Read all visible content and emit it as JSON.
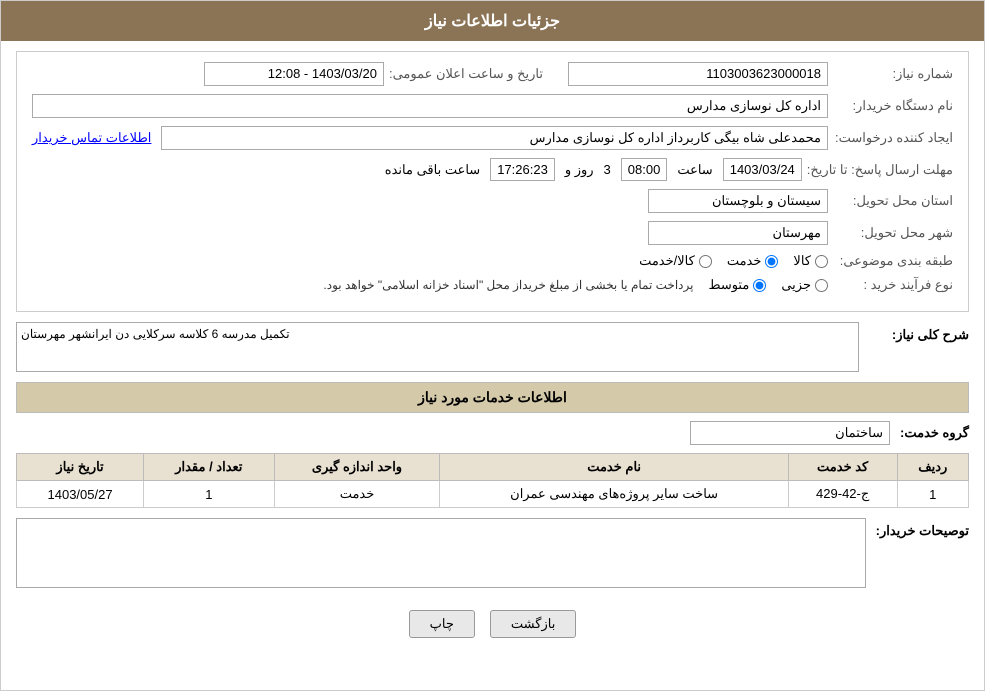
{
  "header": {
    "title": "جزئیات اطلاعات نیاز"
  },
  "fields": {
    "shomareNiaz_label": "شماره نیاز:",
    "shomareNiaz_value": "1103003623000018",
    "tarikh_label": "تاریخ و ساعت اعلان عمومی:",
    "tarikh_value": "1403/03/20 - 12:08",
    "namDastgah_label": "نام دستگاه خریدار:",
    "namDastgah_value": "اداره کل نوسازی مدارس",
    "ijadKonande_label": "ایجاد کننده درخواست:",
    "ijadKonande_value": "محمدعلی شاه بیگی کاربرداز اداره کل نوسازی مدارس",
    "ijadKonande_link": "اطلاعات تماس خریدار",
    "mohlatErsalPasokhTa_label": "مهلت ارسال پاسخ: تا تاریخ:",
    "mohlatDate_value": "1403/03/24",
    "mohlatSaat_label": "ساعت",
    "mohlatSaat_value": "08:00",
    "roz_label": "روز و",
    "roz_value": "3",
    "saat_label": "ساعت باقی مانده",
    "countdown_value": "17:26:23",
    "ostan_label": "استان محل تحویل:",
    "ostan_value": "سیستان و بلوچستان",
    "shahr_label": "شهر محل تحویل:",
    "shahr_value": "مهرستان",
    "tabaqeBandi_label": "طبقه بندی موضوعی:",
    "tabaqeRadios": [
      {
        "label": "کالا",
        "value": "kala"
      },
      {
        "label": "خدمت",
        "value": "khedmat"
      },
      {
        "label": "کالا/خدمت",
        "value": "kala_khedmat"
      }
    ],
    "tabaqeSelected": "khedmat",
    "noeFarayand_label": "نوع فرآیند خرید :",
    "noeFarayandRadios": [
      {
        "label": "جزیی",
        "value": "jozii"
      },
      {
        "label": "متوسط",
        "value": "motavasset"
      }
    ],
    "noeFarayandSelected": "motavasset",
    "noeFarayandNote": "پرداخت تمام یا بخشی از مبلغ خریداز محل \"اسناد خزانه اسلامی\" خواهد بود.",
    "sharhKoli_label": "شرح کلی نیاز:",
    "sharhKoli_value": "تکمیل مدرسه 6 کلاسه سرکلایی دن ایرانشهر مهرستان",
    "khadamatSection_title": "اطلاعات خدمات مورد نیاز",
    "groheKhedmat_label": "گروه خدمت:",
    "groheKhedmat_value": "ساختمان",
    "table": {
      "headers": [
        "ردیف",
        "کد خدمت",
        "نام خدمت",
        "واحد اندازه گیری",
        "تعداد / مقدار",
        "تاریخ نیاز"
      ],
      "rows": [
        {
          "radif": "1",
          "kodKhedmat": "ج-42-429",
          "namKhedmat": "ساخت سایر پروژه‌های مهندسی عمران",
          "vahed": "خدمت",
          "tedad": "1",
          "tarikh": "1403/05/27"
        }
      ]
    },
    "tosifatKharidar_label": "توصیحات خریدار:",
    "tosifatKharidar_value": "",
    "buttons": {
      "chap": "چاپ",
      "bazgasht": "بازگشت"
    }
  }
}
